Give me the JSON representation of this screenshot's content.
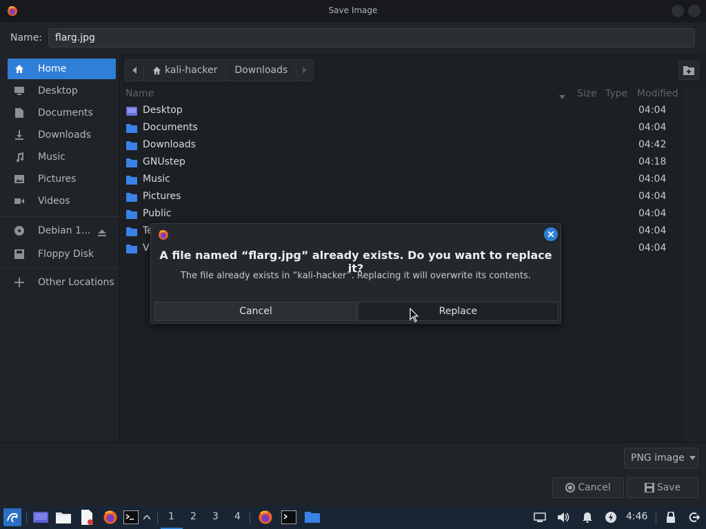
{
  "window": {
    "title": "Save Image"
  },
  "name_row": {
    "label": "Name:",
    "value": "flarg.jpg"
  },
  "sidebar": {
    "items": [
      {
        "label": "Home",
        "icon": "home-icon",
        "active": true
      },
      {
        "label": "Desktop",
        "icon": "desktop-icon"
      },
      {
        "label": "Documents",
        "icon": "document-icon"
      },
      {
        "label": "Downloads",
        "icon": "download-icon"
      },
      {
        "label": "Music",
        "icon": "music-icon"
      },
      {
        "label": "Pictures",
        "icon": "picture-icon"
      },
      {
        "label": "Videos",
        "icon": "video-icon"
      },
      {
        "label": "Debian 1...",
        "icon": "disc-icon"
      },
      {
        "label": "Floppy Disk",
        "icon": "floppy-icon"
      },
      {
        "label": "Other Locations",
        "icon": "plus-icon"
      }
    ]
  },
  "pathbar": {
    "segments": [
      "kali-hacker",
      "Downloads"
    ]
  },
  "columns": {
    "name": "Name",
    "size": "Size",
    "type": "Type",
    "modified": "Modified"
  },
  "files": [
    {
      "name": "Desktop",
      "modified": "04:04"
    },
    {
      "name": "Documents",
      "modified": "04:04"
    },
    {
      "name": "Downloads",
      "modified": "04:42"
    },
    {
      "name": "GNUstep",
      "modified": "04:18"
    },
    {
      "name": "Music",
      "modified": "04:04"
    },
    {
      "name": "Pictures",
      "modified": "04:04"
    },
    {
      "name": "Public",
      "modified": "04:04"
    },
    {
      "name": "Te",
      "modified": "04:04"
    },
    {
      "name": "V",
      "modified": "04:04"
    }
  ],
  "bottom": {
    "filter": "PNG image",
    "cancel": "Cancel",
    "save": "Save"
  },
  "dialog": {
    "heading": "A file named “flarg.jpg” already exists.  Do you want to replace it?",
    "message": "The file already exists in “kali-hacker”.  Replacing it will overwrite its contents.",
    "cancel": "Cancel",
    "replace": "Replace"
  },
  "taskbar": {
    "workspaces": [
      "1",
      "2",
      "3",
      "4"
    ],
    "active_workspace": "1",
    "clock": "4:46"
  },
  "colors": {
    "accent": "#2f7fd8",
    "folder": "#3b82e8",
    "background": "#202327"
  }
}
